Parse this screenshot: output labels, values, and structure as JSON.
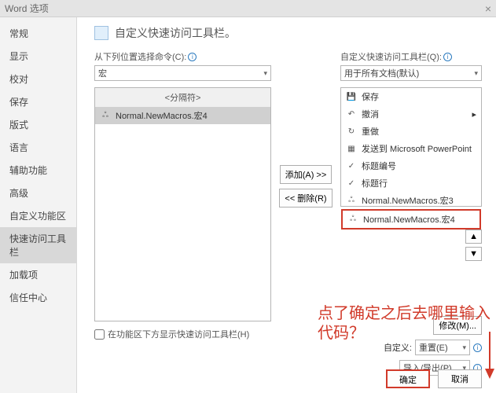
{
  "titlebar": {
    "title": "Word 选项"
  },
  "sidebar": {
    "items": [
      {
        "label": "常规"
      },
      {
        "label": "显示"
      },
      {
        "label": "校对"
      },
      {
        "label": "保存"
      },
      {
        "label": "版式"
      },
      {
        "label": "语言"
      },
      {
        "label": "辅助功能"
      },
      {
        "label": "高级"
      },
      {
        "label": "自定义功能区"
      },
      {
        "label": "快速访问工具栏",
        "selected": true
      },
      {
        "label": "加载项"
      },
      {
        "label": "信任中心"
      }
    ]
  },
  "heading": "自定义快速访问工具栏。",
  "left": {
    "choose_label": "从下列位置选择命令(C):",
    "choose_value": "宏",
    "list_header": "<分隔符>",
    "items": [
      {
        "icon": "macro",
        "label": "Normal.NewMacros.宏4",
        "selected": true
      }
    ]
  },
  "mid": {
    "add": "添加(A) >>",
    "remove": "<< 删除(R)"
  },
  "right": {
    "target_label": "自定义快速访问工具栏(Q):",
    "target_value": "用于所有文档(默认)",
    "items": [
      {
        "icon": "save",
        "label": "保存"
      },
      {
        "icon": "undo",
        "label": "撤消",
        "dd": true
      },
      {
        "icon": "redo",
        "label": "重做"
      },
      {
        "icon": "ppt",
        "label": "发送到 Microsoft PowerPoint"
      },
      {
        "icon": "heading",
        "label": "标题编号"
      },
      {
        "icon": "title",
        "label": "标题行"
      },
      {
        "icon": "macro",
        "label": "Normal.NewMacros.宏3"
      },
      {
        "icon": "macro",
        "label": "Normal.NewMacros.宏4",
        "highlight": true
      }
    ],
    "up": "▲",
    "down": "▼"
  },
  "checkbox": "在功能区下方显示快速访问工具栏(H)",
  "ctrls": {
    "modify_label": "修改(M)...",
    "custom_label": "自定义:",
    "reset": "重置(E)",
    "importexport": "导入/导出(P)"
  },
  "footer": {
    "ok": "确定",
    "cancel": "取消"
  },
  "annotation": {
    "line1": "点了确定之后去哪里输入",
    "line2": "代码？"
  },
  "icons": {
    "save": "💾",
    "undo": "↶",
    "redo": "↻",
    "ppt": "▦",
    "heading": "✓",
    "title": "✓",
    "macro": "ஃ"
  }
}
